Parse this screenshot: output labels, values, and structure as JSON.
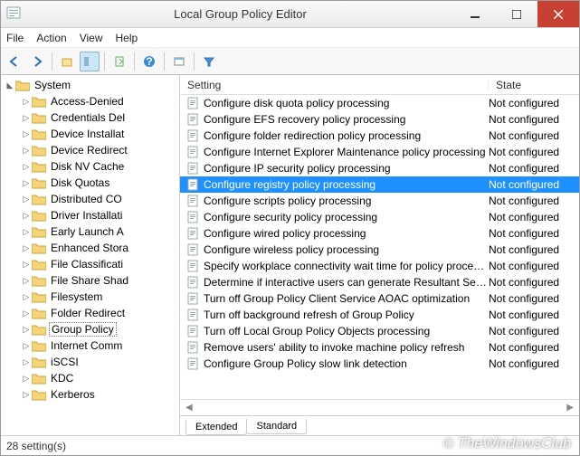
{
  "window": {
    "title": "Local Group Policy Editor"
  },
  "menu": {
    "file": "File",
    "action": "Action",
    "view": "View",
    "help": "Help"
  },
  "tree": {
    "root": "System",
    "items": [
      "Access-Denied",
      "Credentials Del",
      "Device Installat",
      "Device Redirect",
      "Disk NV Cache",
      "Disk Quotas",
      "Distributed CO",
      "Driver Installati",
      "Early Launch A",
      "Enhanced Stora",
      "File Classificati",
      "File Share Shad",
      "Filesystem",
      "Folder Redirect",
      "Group Policy",
      "Internet Comm",
      "iSCSI",
      "KDC",
      "Kerberos"
    ],
    "selected": "Group Policy"
  },
  "columns": {
    "setting": "Setting",
    "state": "State"
  },
  "rows": [
    {
      "name": "Configure disk quota policy processing",
      "state": "Not configured"
    },
    {
      "name": "Configure EFS recovery policy processing",
      "state": "Not configured"
    },
    {
      "name": "Configure folder redirection policy processing",
      "state": "Not configured"
    },
    {
      "name": "Configure Internet Explorer Maintenance policy processing",
      "state": "Not configured"
    },
    {
      "name": "Configure IP security policy processing",
      "state": "Not configured"
    },
    {
      "name": "Configure registry policy processing",
      "state": "Not configured",
      "selected": true
    },
    {
      "name": "Configure scripts policy processing",
      "state": "Not configured"
    },
    {
      "name": "Configure security policy processing",
      "state": "Not configured"
    },
    {
      "name": "Configure wired policy processing",
      "state": "Not configured"
    },
    {
      "name": "Configure wireless policy processing",
      "state": "Not configured"
    },
    {
      "name": "Specify workplace connectivity wait time for policy processi...",
      "state": "Not configured"
    },
    {
      "name": "Determine if interactive users can generate Resultant Set of ...",
      "state": "Not configured"
    },
    {
      "name": "Turn off Group Policy Client Service AOAC optimization",
      "state": "Not configured"
    },
    {
      "name": "Turn off background refresh of Group Policy",
      "state": "Not configured"
    },
    {
      "name": "Turn off Local Group Policy Objects processing",
      "state": "Not configured"
    },
    {
      "name": "Remove users' ability to invoke machine policy refresh",
      "state": "Not configured"
    },
    {
      "name": "Configure Group Policy slow link detection",
      "state": "Not configured"
    }
  ],
  "tabs": {
    "extended": "Extended",
    "standard": "Standard"
  },
  "status": {
    "text": "28 setting(s)"
  },
  "watermark": "© TheWindowsClub"
}
